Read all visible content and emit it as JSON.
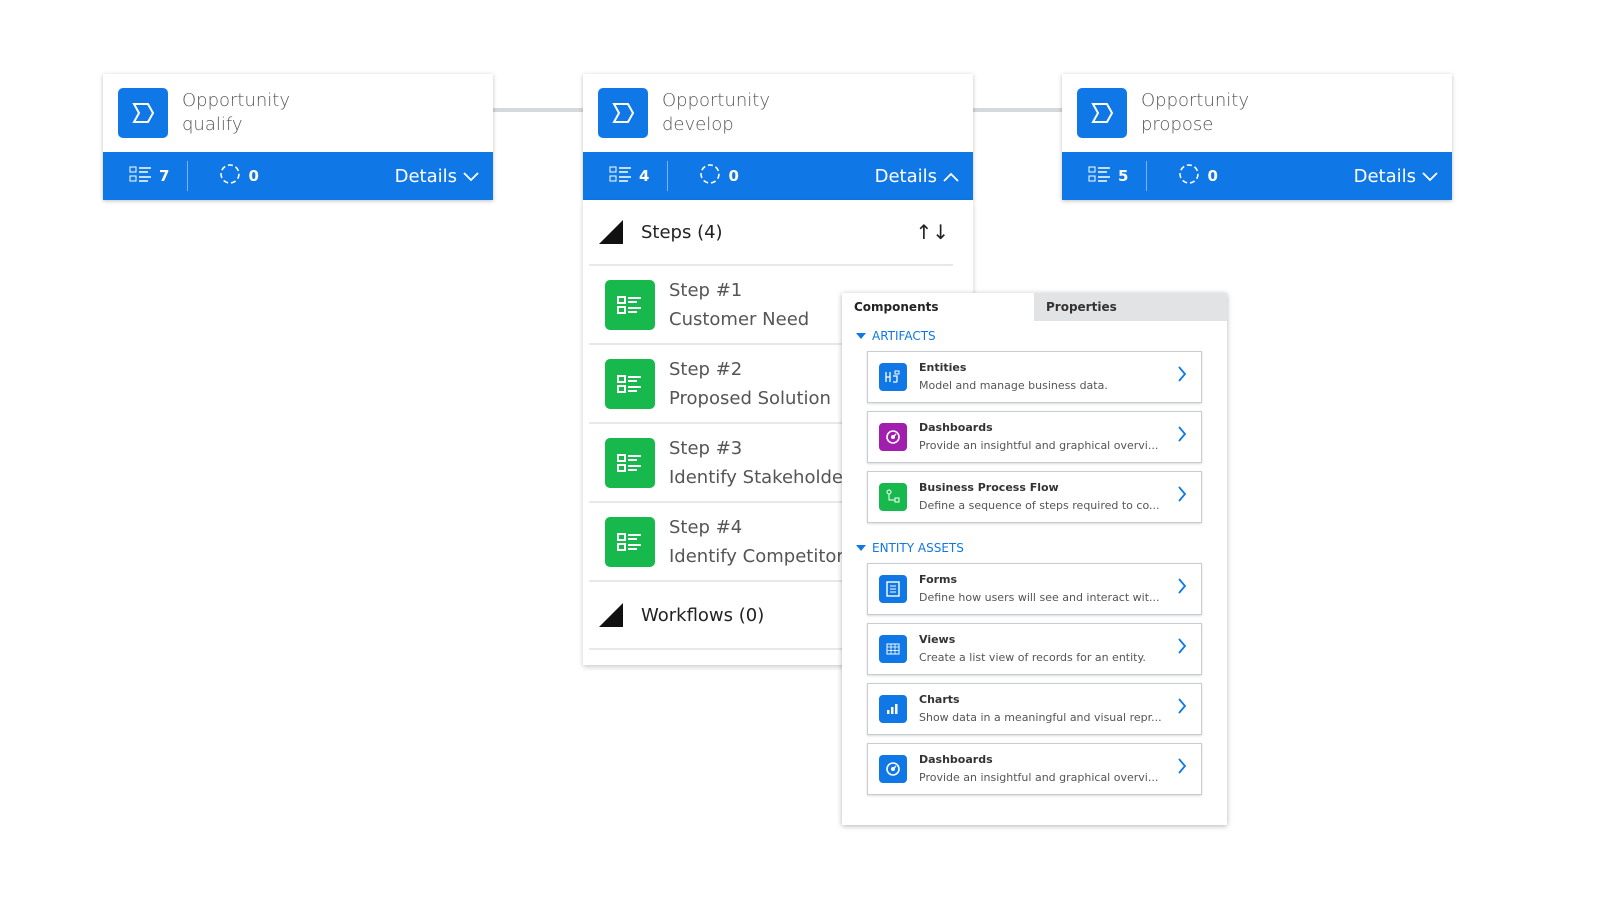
{
  "stages": [
    {
      "title_line1": "Opportunity",
      "title_line2": "qualify",
      "steps_count": "7",
      "workflows_count": "0",
      "details_label": "Details",
      "expanded": false
    },
    {
      "title_line1": "Opportunity",
      "title_line2": "develop",
      "steps_count": "4",
      "workflows_count": "0",
      "details_label": "Details",
      "expanded": true
    },
    {
      "title_line1": "Opportunity",
      "title_line2": "propose",
      "steps_count": "5",
      "workflows_count": "0",
      "details_label": "Details",
      "expanded": false
    }
  ],
  "details_panel": {
    "steps_header": "Steps (4)",
    "sort_label": "↑↓",
    "steps": [
      {
        "label": "Step #1",
        "name": "Customer Need"
      },
      {
        "label": "Step #2",
        "name": "Proposed Solution"
      },
      {
        "label": "Step #3",
        "name": "Identify Stakeholders"
      },
      {
        "label": "Step #4",
        "name": "Identify Competitors"
      }
    ],
    "workflows_header": "Workflows (0)"
  },
  "components_panel": {
    "tabs": [
      "Components",
      "Properties"
    ],
    "groups": [
      {
        "label": "ARTIFACTS",
        "items": [
          {
            "title": "Entities",
            "desc": "Model and manage business data.",
            "icon": "entities-icon",
            "color": "#0f78e6"
          },
          {
            "title": "Dashboards",
            "desc": "Provide an insightful and graphical overvi...",
            "icon": "dashboard-icon",
            "color": "#a01fae"
          },
          {
            "title": "Business Process Flow",
            "desc": "Define a sequence of steps required to co...",
            "icon": "process-flow-icon",
            "color": "#18b94c"
          }
        ]
      },
      {
        "label": "ENTITY ASSETS",
        "items": [
          {
            "title": "Forms",
            "desc": "Define how users will see and interact wit...",
            "icon": "form-icon",
            "color": "#0f78e6"
          },
          {
            "title": "Views",
            "desc": "Create a list view of records for an entity.",
            "icon": "view-grid-icon",
            "color": "#0f78e6"
          },
          {
            "title": "Charts",
            "desc": "Show data in a meaningful and visual repr...",
            "icon": "chart-icon",
            "color": "#0f78e6"
          },
          {
            "title": "Dashboards",
            "desc": "Provide an insightful and graphical overvi...",
            "icon": "dashboard-icon",
            "color": "#0f78e6"
          }
        ]
      }
    ]
  }
}
